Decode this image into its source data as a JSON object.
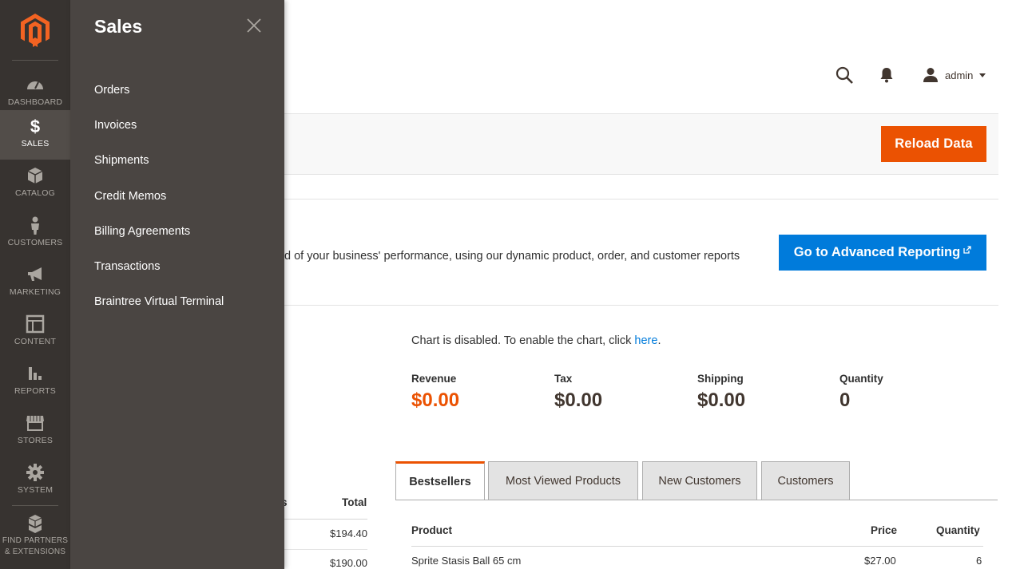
{
  "nav": {
    "items": [
      {
        "label": "DASHBOARD",
        "icon": "dashboard-icon"
      },
      {
        "label": "SALES",
        "icon": "dollar-icon"
      },
      {
        "label": "CATALOG",
        "icon": "cube-icon"
      },
      {
        "label": "CUSTOMERS",
        "icon": "person-icon"
      },
      {
        "label": "MARKETING",
        "icon": "megaphone-icon"
      },
      {
        "label": "CONTENT",
        "icon": "layout-icon"
      },
      {
        "label": "REPORTS",
        "icon": "bar-chart-icon"
      },
      {
        "label": "STORES",
        "icon": "store-icon"
      },
      {
        "label": "SYSTEM",
        "icon": "gear-icon"
      },
      {
        "label_line1": "FIND PARTNERS",
        "label_line2": "& EXTENSIONS",
        "icon": "boxes-icon"
      }
    ],
    "active": "SALES"
  },
  "flyout": {
    "title": "Sales",
    "items": [
      "Orders",
      "Invoices",
      "Shipments",
      "Credit Memos",
      "Billing Agreements",
      "Transactions",
      "Braintree Virtual Terminal"
    ]
  },
  "header": {
    "user": "admin"
  },
  "actions": {
    "reload": "Reload Data"
  },
  "advanced": {
    "text": "d of your business' performance, using our dynamic product, order, and customer reports",
    "button": "Go to Advanced Reporting"
  },
  "chart_note": {
    "text": "Chart is disabled. To enable the chart, click ",
    "link": "here",
    "suffix": "."
  },
  "stats": [
    {
      "label": "Revenue",
      "value": "$0.00"
    },
    {
      "label": "Tax",
      "value": "$0.00"
    },
    {
      "label": "Shipping",
      "value": "$0.00"
    },
    {
      "label": "Quantity",
      "value": "0"
    }
  ],
  "left_table": {
    "header_partial": "s",
    "header_total": "Total",
    "rows": [
      "$194.40",
      "$190.00"
    ]
  },
  "tabs": [
    "Bestsellers",
    "Most Viewed Products",
    "New Customers",
    "Customers"
  ],
  "grid": {
    "headers": {
      "product": "Product",
      "price": "Price",
      "quantity": "Quantity"
    },
    "rows": [
      {
        "product": "Sprite Stasis Ball 65 cm",
        "price": "$27.00",
        "quantity": "6"
      }
    ]
  },
  "colors": {
    "accent": "#eb5202",
    "link": "#007bdb",
    "nav_bg": "#373330",
    "flyout_bg": "#4a4542"
  }
}
